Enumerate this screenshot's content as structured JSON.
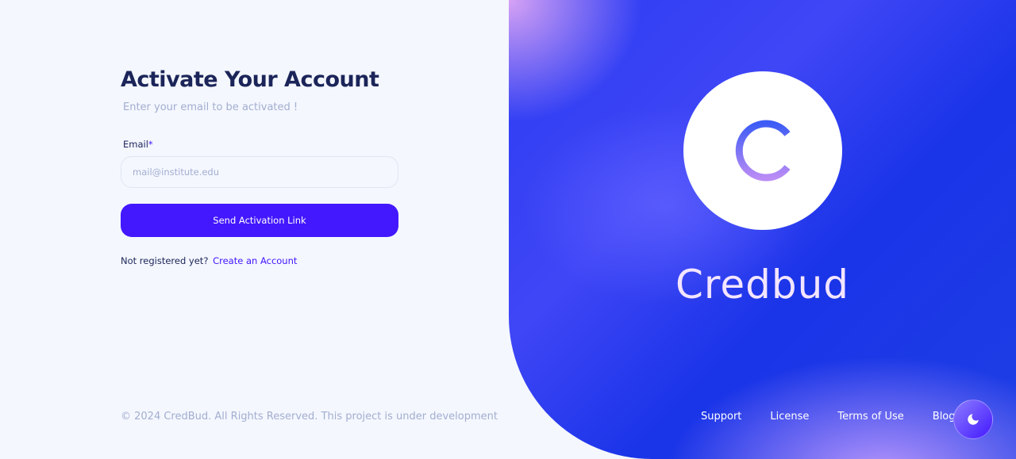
{
  "form": {
    "title": "Activate Your Account",
    "subtitle": "Enter your email to be activated !",
    "email_label": "Email",
    "required_mark": "*",
    "email_placeholder": "mail@institute.edu",
    "email_value": "",
    "submit_label": "Send Activation Link",
    "register_prompt": "Not registered yet?",
    "register_link": "Create an Account"
  },
  "footer": {
    "copyright": "© 2024 CredBud. All Rights Reserved. This project is under development",
    "links": [
      "Support",
      "License",
      "Terms of Use",
      "Blog"
    ]
  },
  "brand": {
    "logo_letter": "C",
    "name": "Credbud"
  },
  "theme_toggle": {
    "icon": "moon-icon"
  },
  "colors": {
    "accent": "#4318ff",
    "heading": "#1b2559",
    "muted": "#a3aed0",
    "page_bg": "#f4f7fe",
    "panel_blue": "#2b3cf2"
  }
}
